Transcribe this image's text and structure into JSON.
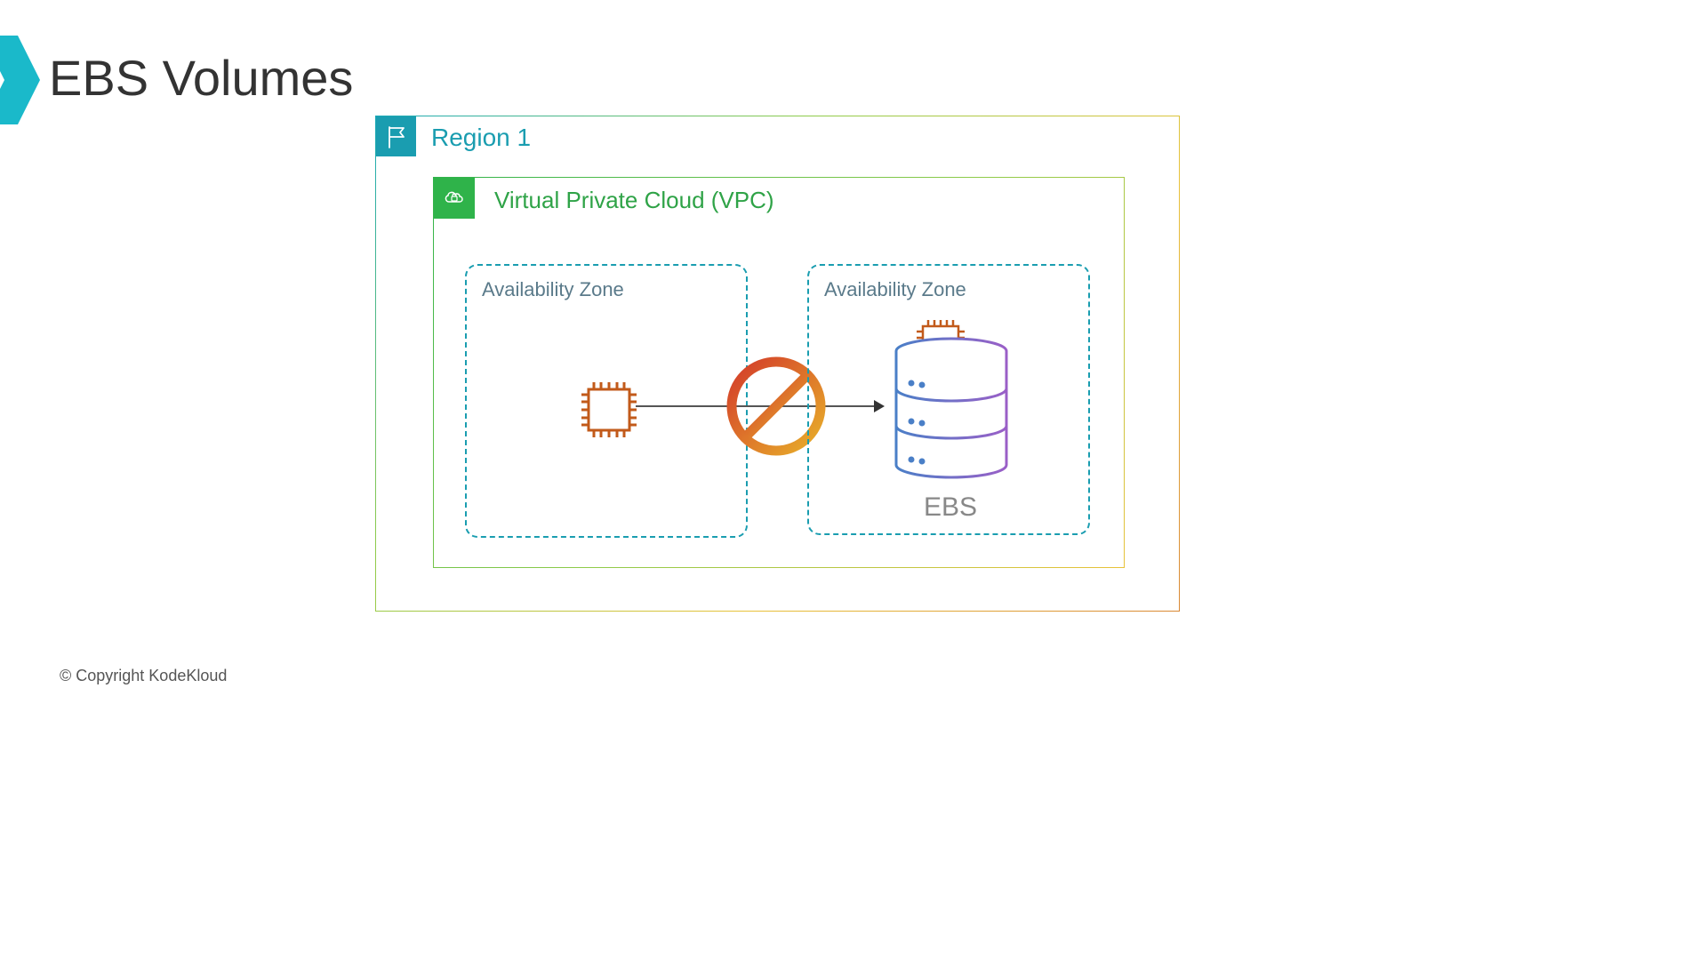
{
  "title": "EBS Volumes",
  "region": {
    "label": "Region 1"
  },
  "vpc": {
    "label": "Virtual Private Cloud (VPC)"
  },
  "az1": {
    "label": "Availability Zone"
  },
  "az2": {
    "label": "Availability Zone",
    "volume_label": "EBS"
  },
  "copyright": "© Copyright KodeKloud"
}
